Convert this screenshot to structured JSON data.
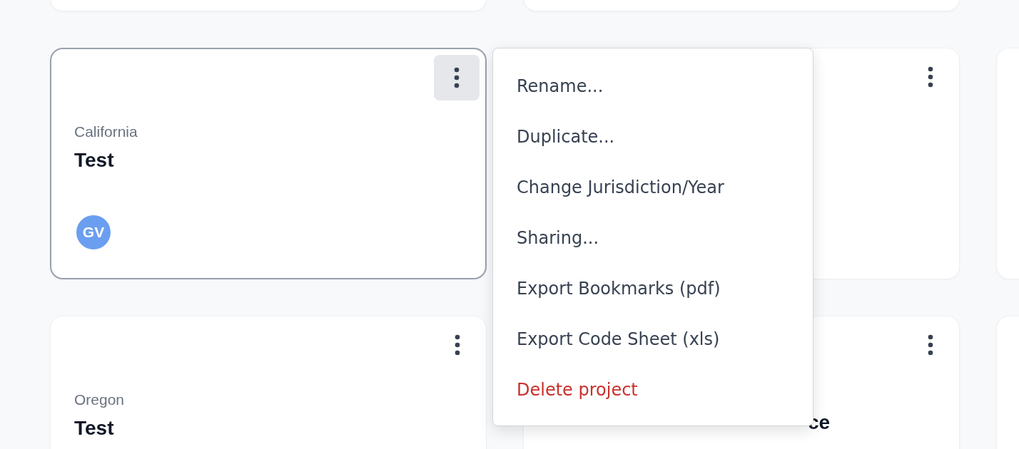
{
  "card_rows": [
    {
      "cards": [
        {
          "highlighted": false
        },
        {
          "highlighted": false
        }
      ]
    },
    {
      "cards": [
        {
          "highlighted": true,
          "location": "California",
          "title": "Test",
          "avatar": {
            "initials": "GV",
            "color": "#6b9ef0"
          },
          "kebab": {
            "active": true
          }
        },
        {
          "highlighted": false,
          "kebab": {
            "active": false
          }
        },
        {
          "highlighted": false
        }
      ]
    },
    {
      "cards": [
        {
          "highlighted": false,
          "location": "Oregon",
          "title": "Test",
          "kebab": {
            "active": false
          }
        },
        {
          "highlighted": false,
          "title": "ce",
          "partly_covered": true,
          "kebab": {
            "active": false
          }
        },
        {
          "highlighted": false
        }
      ]
    }
  ],
  "context_menu": {
    "items": [
      {
        "label": "Rename...",
        "kind": "normal"
      },
      {
        "label": "Duplicate...",
        "kind": "normal"
      },
      {
        "label": "Change Jurisdiction/Year",
        "kind": "normal"
      },
      {
        "label": "Sharing...",
        "kind": "normal"
      },
      {
        "label": "Export Bookmarks (pdf)",
        "kind": "normal"
      },
      {
        "label": "Export Code Sheet (xls)",
        "kind": "normal"
      },
      {
        "label": "Delete project",
        "kind": "danger"
      }
    ]
  }
}
